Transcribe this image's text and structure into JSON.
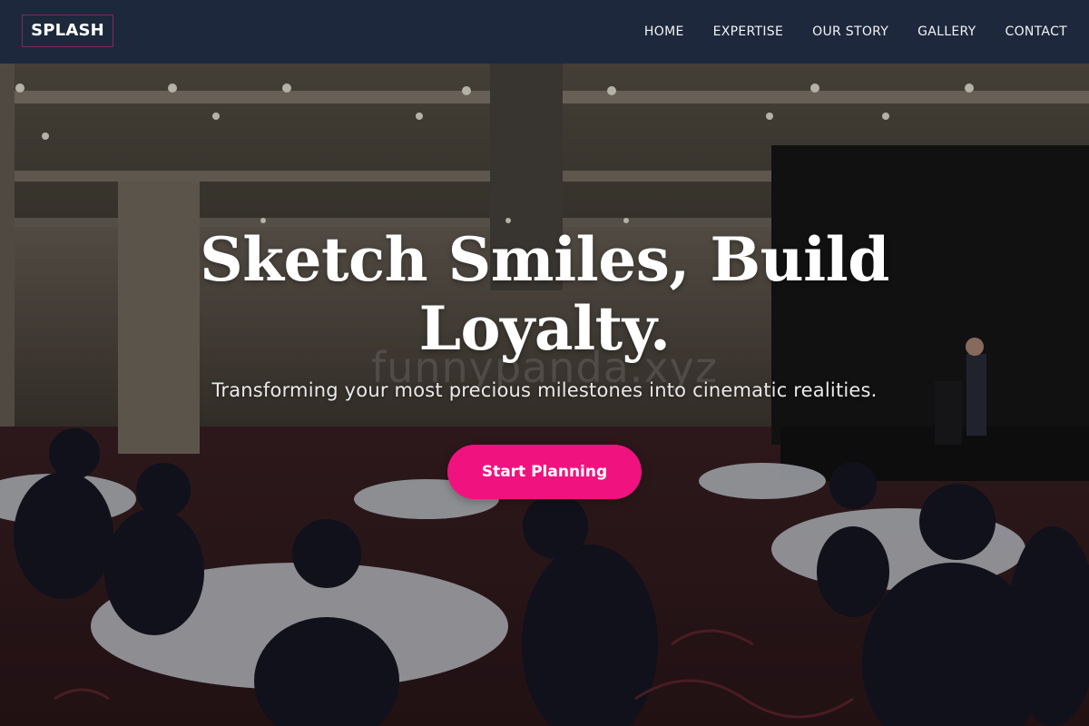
{
  "brand": {
    "name": "SPLASH"
  },
  "nav": {
    "items": [
      {
        "label": "HOME"
      },
      {
        "label": "EXPERTISE"
      },
      {
        "label": "OUR STORY"
      },
      {
        "label": "GALLERY"
      },
      {
        "label": "CONTACT"
      }
    ]
  },
  "hero": {
    "headline": "Sketch Smiles, Build Loyalty.",
    "subline": "Transforming your most precious milestones into cinematic realities.",
    "cta_label": "Start Planning",
    "watermark": "funnypanda.xyz",
    "background": "banquet-hall-photo"
  },
  "colors": {
    "nav_bg": "#1d283c",
    "cta": "#f0127f",
    "logo_border": "#7c2a63"
  }
}
